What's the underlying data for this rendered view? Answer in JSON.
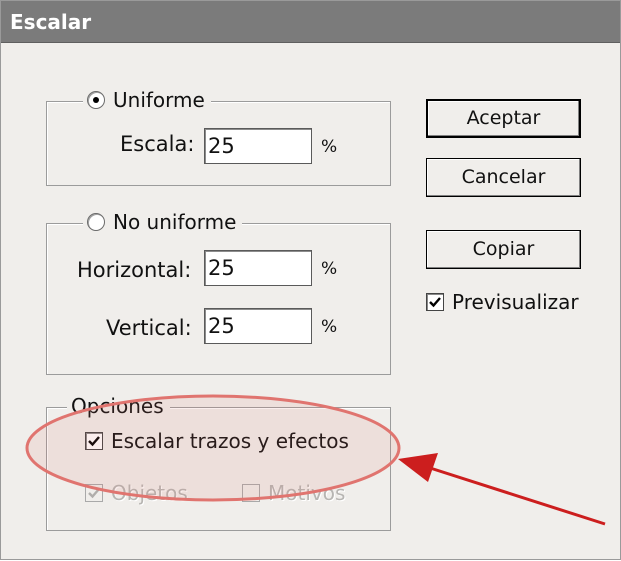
{
  "window": {
    "title": "Escalar"
  },
  "uniform": {
    "label": "Uniforme",
    "selected": true,
    "scale_label": "Escala:",
    "scale_value": "25",
    "unit": "%"
  },
  "non_uniform": {
    "label": "No uniforme",
    "selected": false,
    "horizontal_label": "Horizontal:",
    "horizontal_value": "25",
    "vertical_label": "Vertical:",
    "vertical_value": "25",
    "unit": "%"
  },
  "buttons": {
    "ok": "Aceptar",
    "cancel": "Cancelar",
    "copy": "Copiar"
  },
  "preview": {
    "label": "Previsualizar",
    "checked": true
  },
  "options": {
    "label": "Opciones",
    "scale_strokes_label": "Escalar trazos y efectos",
    "scale_strokes_checked": true,
    "objects_label": "Objetos",
    "objects_checked": true,
    "objects_enabled": false,
    "patterns_label": "Motivos",
    "patterns_checked": false,
    "patterns_enabled": false
  },
  "annotation": {
    "color": "#cc1e1e",
    "highlight_color": "#e0746f"
  }
}
